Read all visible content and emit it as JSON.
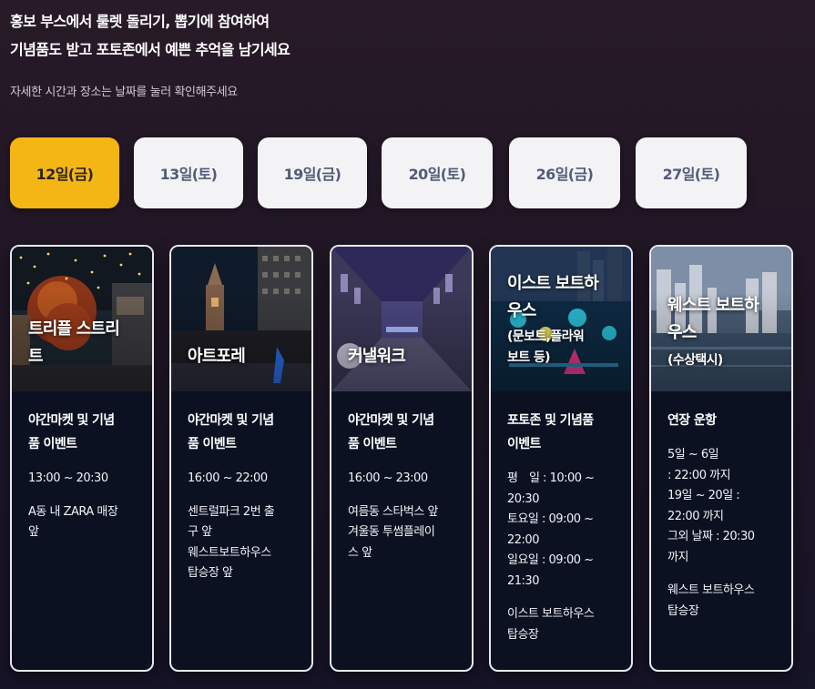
{
  "header": {
    "headline_line1": "홍보 부스에서 룰렛 돌리기, 뽑기에 참여하여",
    "headline_line2": "기념품도 받고 포토존에서 예쁜 추억을 남기세요",
    "subtext": "자세한 시간과 장소는 날짜를 눌러 확인해주세요"
  },
  "tabs": [
    {
      "label": "12일(금)",
      "active": true
    },
    {
      "label": "13일(토)",
      "active": false
    },
    {
      "label": "19일(금)",
      "active": false
    },
    {
      "label": "20일(토)",
      "active": false
    },
    {
      "label": "26일(금)",
      "active": false
    },
    {
      "label": "27일(토)",
      "active": false
    }
  ],
  "colors": {
    "active_tab": "#f4b614",
    "tab": "#f3f3f6",
    "card_bg": "#0c1122",
    "card_border": "#e8e8ee"
  },
  "cards": [
    {
      "place_line1": "트리플 스트리",
      "place_line2": "트",
      "event_line1": "야간마켓 및 기념",
      "event_line2": "품 이벤트",
      "time": "13:00 ~ 20:30",
      "loc_line1": "A동 내 ZARA 매장",
      "loc_line2": "앞"
    },
    {
      "place_line1": "아트포레",
      "event_line1": "야간마켓 및 기념",
      "event_line2": "품 이벤트",
      "time": "16:00 ~ 22:00",
      "loc_line1": "센트럴파크 2번 출",
      "loc_line2": "구 앞",
      "loc_line3": "웨스트보트하우스",
      "loc_line4": "탑승장 앞"
    },
    {
      "place_line1": "커낼워크",
      "event_line1": "야간마켓 및 기념",
      "event_line2": "품 이벤트",
      "time": "16:00 ~ 23:00",
      "loc_line1": "여름동 스타벅스 앞",
      "loc_line2": "겨울동 투썸플레이",
      "loc_line3": "스 앞"
    },
    {
      "place_line1": "이스트 보트하",
      "place_line2": "우스",
      "sub_line1": "(문보트,플라워",
      "sub_line2": "보트 등)",
      "event_line1": "포토존 및 기념품",
      "event_line2": "이벤트",
      "time_line1": "평　일 : 10:00 ~",
      "time_line2": "20:30",
      "time_line3": "토요일 : 09:00 ~",
      "time_line4": "22:00",
      "time_line5": "일요일 : 09:00 ~",
      "time_line6": "21:30",
      "loc_line1": "이스트 보트하우스",
      "loc_line2": "탑승장"
    },
    {
      "place_line1": "웨스트 보트하",
      "place_line2": "우스",
      "sub_line1": "(수상택시)",
      "event_line1": "연장 운항",
      "time_line1": "5일 ~ 6일",
      "time_line2": ": 22:00 까지",
      "time_line3": "19일 ~ 20일 :",
      "time_line4": "22:00 까지",
      "time_line5": "그외 날짜 : 20:30",
      "time_line6": "까지",
      "loc_line1": "웨스트 보트하우스",
      "loc_line2": "탑승장"
    }
  ]
}
